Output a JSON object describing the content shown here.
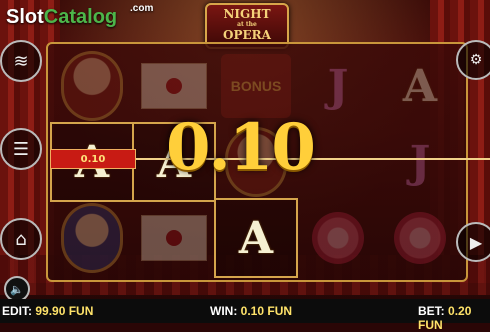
{
  "site_logo": {
    "part1": "Slot",
    "part2": "Catalog",
    "suffix": ".com"
  },
  "game_logo": {
    "line1": "NIGHT",
    "line2": "at the",
    "line3": "OPERA"
  },
  "reels": {
    "row1": [
      "portrait-lady",
      "envelope",
      "BONUS",
      "J",
      "A"
    ],
    "row2": [
      "A",
      "A",
      "portrait-lady",
      "",
      "J"
    ],
    "row3": [
      "portrait-man",
      "envelope",
      "A",
      "rose",
      "rose"
    ]
  },
  "symbols": {
    "bonus": "BONUS",
    "letter_A": "A",
    "letter_J": "J"
  },
  "win_display": {
    "big_amount": "0.10",
    "line_tag": "0.10"
  },
  "footer": {
    "credit_label": "EDIT:",
    "credit_value": "99.90 FUN",
    "win_label": "WIN:",
    "win_value": "0.10 FUN",
    "bet_label": "BET:",
    "bet_value": "0.20 FUN"
  },
  "icons": [
    "coins-icon",
    "menu-icon",
    "home-icon",
    "sound-icon",
    "play-icon",
    "settings-icon"
  ]
}
